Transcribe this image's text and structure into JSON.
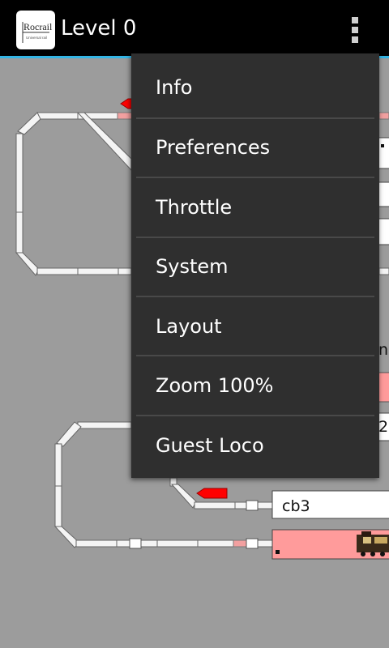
{
  "app": {
    "title": "Level 0",
    "logo_text": "Rocrail",
    "logo_subtext": "Universal rail"
  },
  "icons": {
    "app_icon": "rocrail-logo-icon",
    "overflow": "overflow-menu-icon"
  },
  "menu": {
    "items": [
      {
        "label": "Info"
      },
      {
        "label": "Preferences"
      },
      {
        "label": "Throttle"
      },
      {
        "label": "System"
      },
      {
        "label": "Layout"
      },
      {
        "label": "Zoom 100%"
      },
      {
        "label": "Guest Loco"
      }
    ]
  },
  "layout": {
    "partial_texts": [
      "n",
      "2"
    ],
    "blocks": [
      {
        "label": "cb3"
      }
    ]
  },
  "colors": {
    "actionbar": "#000000",
    "accent": "#33b5e5",
    "menu_bg": "#2f2f2f",
    "canvas_bg": "#9c9c9c",
    "signal_red": "#ff0000",
    "occupied_block": "#ff9b9b"
  }
}
